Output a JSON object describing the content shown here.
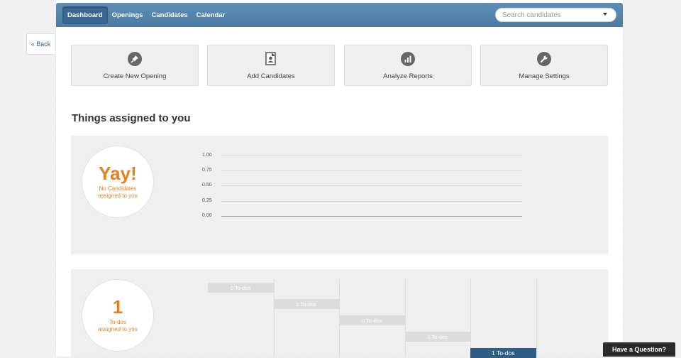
{
  "back_label": "« Back",
  "nav": {
    "items": [
      {
        "label": "Dashboard",
        "active": true
      },
      {
        "label": "Openings",
        "active": false
      },
      {
        "label": "Candidates",
        "active": false
      },
      {
        "label": "Calendar",
        "active": false
      }
    ],
    "search_placeholder": "Search candidates"
  },
  "actions": [
    {
      "label": "Create New Opening",
      "icon": "pin-icon"
    },
    {
      "label": "Add Candidates",
      "icon": "add-candidate-document-icon"
    },
    {
      "label": "Analyze Reports",
      "icon": "bar-chart-icon"
    },
    {
      "label": "Manage Settings",
      "icon": "wrench-icon"
    }
  ],
  "section_title": "Things assigned to you",
  "candidates_summary": {
    "big": "Yay!",
    "line1": "No Candidates",
    "line2": "assigned to you"
  },
  "chart_data": {
    "type": "line",
    "yticks": [
      "1.00",
      "0.75",
      "0.50",
      "0.25",
      "0.00"
    ],
    "ylim": [
      0,
      1
    ],
    "series": []
  },
  "todos_summary": {
    "big": "1",
    "line1": "To-dos",
    "line2": "assigned to you"
  },
  "todos": [
    {
      "label": "0 To-dos",
      "active": false
    },
    {
      "label": "0 To-dos",
      "active": false
    },
    {
      "label": "0 To-dos",
      "active": false
    },
    {
      "label": "0 To-dos",
      "active": false
    },
    {
      "label": "1 To-dos",
      "active": true
    }
  ],
  "help_label": "Have a Question?",
  "colors": {
    "nav": "#4b7aa2",
    "accent": "#e8811a",
    "todo_active": "#2f5f86"
  }
}
